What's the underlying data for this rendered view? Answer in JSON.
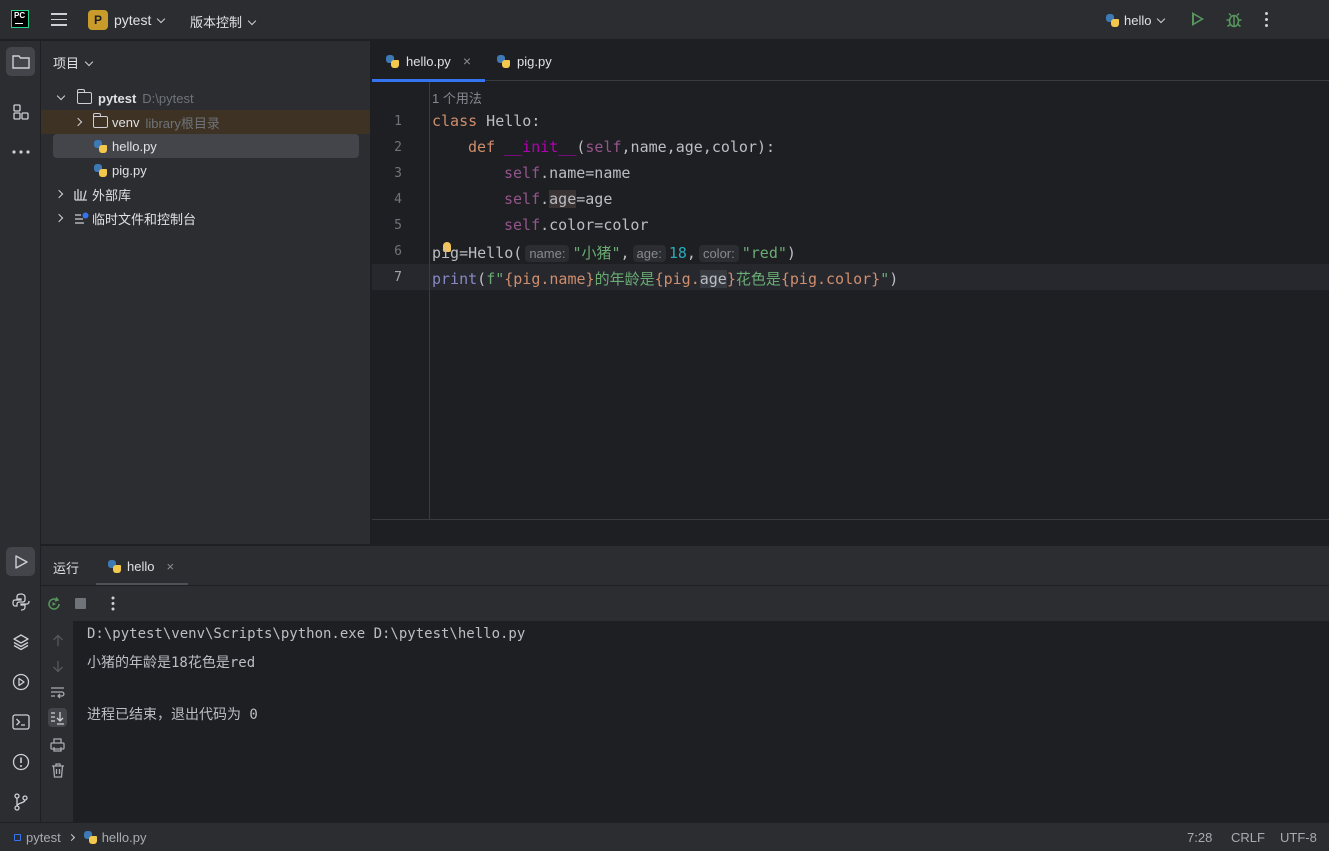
{
  "titlebar": {
    "logo_text": "PC",
    "project_badge": "P",
    "project_name": "pytest",
    "vcs_label": "版本控制",
    "run_config": "hello"
  },
  "project_panel": {
    "title": "项目",
    "tree": [
      {
        "name": "pytest",
        "path": "D:\\pytest"
      },
      {
        "name": "venv",
        "note": "library根目录"
      },
      {
        "name": "hello.py"
      },
      {
        "name": "pig.py"
      },
      {
        "name": "外部库"
      },
      {
        "name": "临时文件和控制台"
      }
    ]
  },
  "editor": {
    "tabs": [
      {
        "label": "hello.py",
        "close": "×"
      },
      {
        "label": "pig.py"
      }
    ],
    "usage_hint": "1 个用法",
    "line_numbers": [
      "1",
      "2",
      "3",
      "4",
      "5",
      "6",
      "7"
    ],
    "code": {
      "l1_kw": "class",
      "l1_name": " Hello:",
      "l2_kw": "def",
      "l2_fn": "__init__",
      "l2_open": "(",
      "l2_self": "self",
      "l2_args": ",name,age,color):",
      "l3_self": "self",
      "l3_rest": ".name=name",
      "l4_self": "self",
      "l4_dot": ".",
      "l4_age": "age",
      "l4_rest": "=age",
      "l5_self": "self",
      "l5_rest": ".color=color",
      "l6_a": "pig=Hello(",
      "l6_hint1": "name:",
      "l6_s1": "\"小猪\"",
      "l6_c1": ",",
      "l6_hint2": "age:",
      "l6_n": "18",
      "l6_c2": ",",
      "l6_hint3": "color:",
      "l6_s2": "\"red\"",
      "l6_end": ")",
      "l7_print": "print",
      "l7_open": "(",
      "l7_f": "f\"",
      "l7_e1": "{pig.name}",
      "l7_t1": "的年龄是",
      "l7_e2a": "{pig.",
      "l7_e2b": "age",
      "l7_e2c": "}",
      "l7_t2": "花色是",
      "l7_e3": "{pig.color}",
      "l7_q": "\"",
      "l7_close": ")"
    }
  },
  "run_panel": {
    "title": "运行",
    "tab_label": "hello",
    "tab_close": "×",
    "output": [
      "D:\\pytest\\venv\\Scripts\\python.exe D:\\pytest\\hello.py",
      "小猪的年龄是18花色是red",
      "",
      "进程已结束，退出代码为 0"
    ]
  },
  "statusbar": {
    "crumbs": [
      "pytest",
      "hello.py"
    ],
    "position": "7:28",
    "line_sep": "CRLF",
    "encoding": "UTF-8"
  },
  "colors": {
    "accent": "#3574f0",
    "run_green": "#57965c",
    "keyword": "#cf8e6d",
    "string": "#6aab73",
    "number": "#2aacb8"
  }
}
